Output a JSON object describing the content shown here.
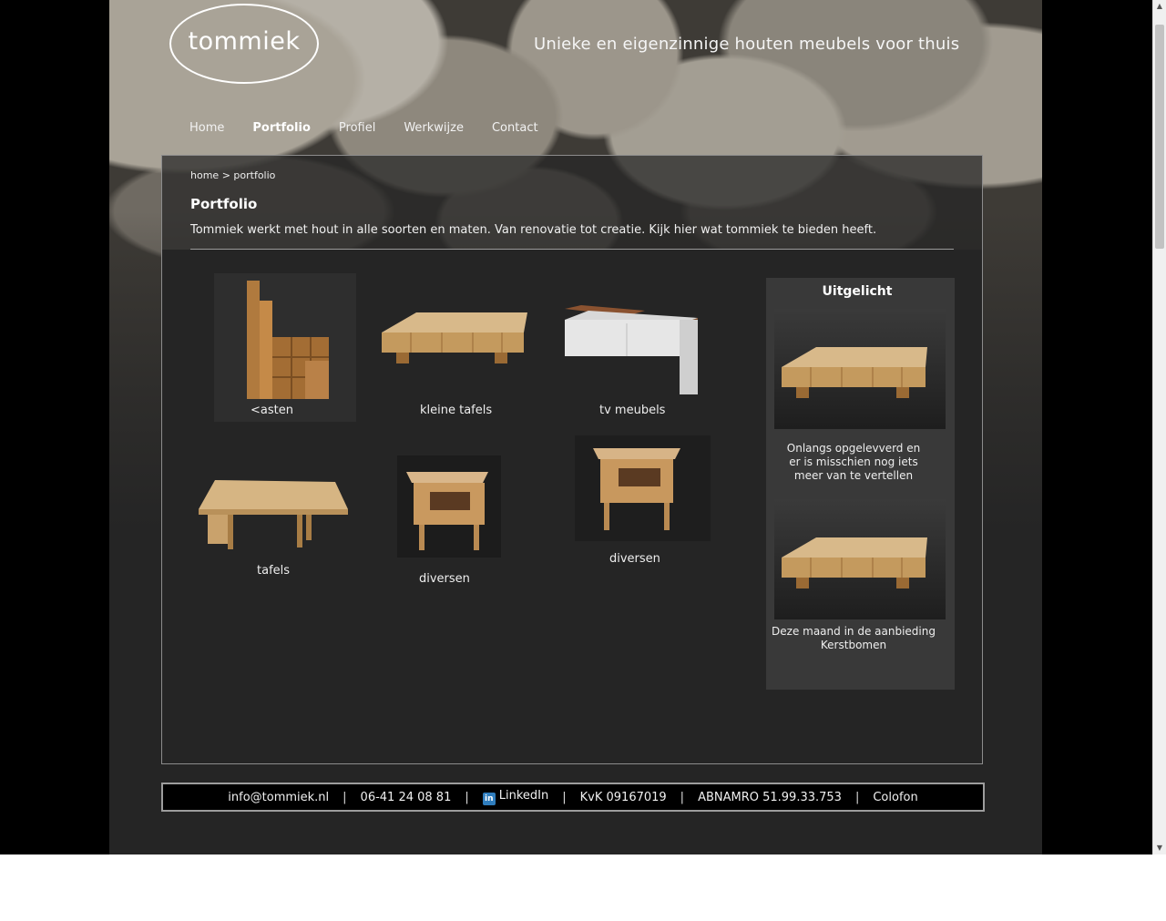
{
  "header": {
    "logo_text": "tommiek",
    "tagline": "Unieke en eigenzinnige houten meubels voor thuis"
  },
  "nav": {
    "items": [
      {
        "label": "Home"
      },
      {
        "label": "Portfolio"
      },
      {
        "label": "Profiel"
      },
      {
        "label": "Werkwijze"
      },
      {
        "label": "Contact"
      }
    ],
    "active": "Portfolio"
  },
  "breadcrumb": {
    "home": "home",
    "separator": ">",
    "current": "portfolio"
  },
  "main": {
    "title": "Portfolio",
    "intro": "Tommiek werkt met hout in alle soorten en maten. Van renovatie tot creatie. Kijk hier wat tommiek te bieden heeft.",
    "items": [
      {
        "label": "<asten",
        "icon": "bookcase-image"
      },
      {
        "label": "kleine tafels",
        "icon": "coffee-table-image"
      },
      {
        "label": "tv meubels",
        "icon": "tv-cabinet-image"
      },
      {
        "label": "tafels",
        "icon": "dining-table-image"
      },
      {
        "label": "diversen",
        "icon": "nightstand-image"
      },
      {
        "label": "diversen",
        "icon": "nightstand-image"
      }
    ]
  },
  "sidebar": {
    "title": "Uitgelicht",
    "featured": [
      {
        "text": "Onlangs opgelevverd en er is misschien nog iets meer van te vertellen",
        "icon": "coffee-table-image"
      },
      {
        "text": "Deze maand in de aanbieding Kerstbomen",
        "icon": "coffee-table-image"
      }
    ]
  },
  "footer": {
    "email": "info@tommiek.nl",
    "phone": "06-41 24 08 81",
    "linkedin": "LinkedIn",
    "linkedin_icon": "in",
    "kvk": "KvK 09167019",
    "bank": "ABNAMRO 51.99.33.753",
    "colofon": "Colofon",
    "separator": "|"
  },
  "colors": {
    "page_bg": "#000000",
    "content_bg": "#252525",
    "sidebar_bg": "#393939",
    "linkedin_blue": "#2f7dbd"
  }
}
